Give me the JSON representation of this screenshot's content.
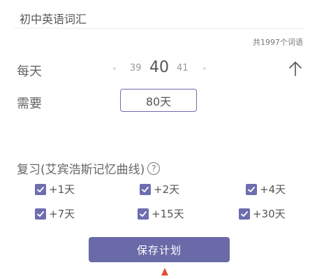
{
  "header": {
    "title": "初中英语词汇",
    "word_count": "共1997个词语"
  },
  "daily": {
    "label": "每天",
    "prev": "39",
    "current": "40",
    "next": "41"
  },
  "need": {
    "label": "需要",
    "value": "80天"
  },
  "review": {
    "label": "复习(艾宾浩斯记忆曲线)",
    "help_icon": "?",
    "options": [
      {
        "label": "+1天",
        "checked": true
      },
      {
        "label": "+2天",
        "checked": true
      },
      {
        "label": "+4天",
        "checked": true
      },
      {
        "label": "+7天",
        "checked": true
      },
      {
        "label": "+15天",
        "checked": true
      },
      {
        "label": "+30天",
        "checked": true
      }
    ]
  },
  "actions": {
    "save_label": "保存计划"
  },
  "colors": {
    "accent": "#6e6db0",
    "button": "#6a6aa8",
    "pointer": "#e0503a"
  }
}
